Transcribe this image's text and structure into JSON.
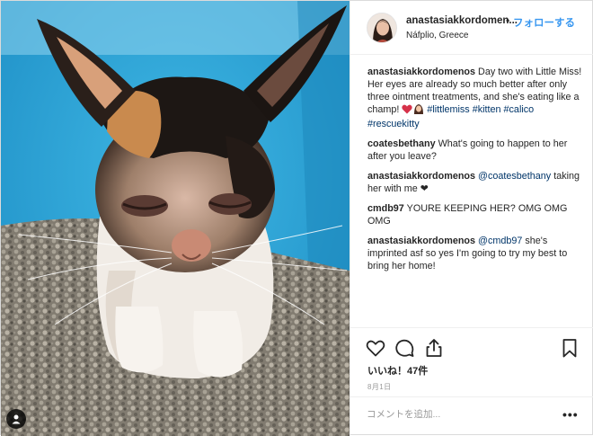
{
  "post": {
    "author": {
      "username": "anastasiakkordomen...",
      "location": "Náfplio, Greece",
      "follow_label": "フォローする",
      "separator": "•",
      "avatar_icon": "profile-avatar"
    },
    "photo": {
      "tag_icon": "person-tag-icon"
    },
    "caption": {
      "username": "anastasiakkordomenos",
      "text": " Day two with Little Miss! Her eyes are already so much better after only three ointment treatments, and she's eating like a champ! ",
      "hashtag_1": "#littlemiss",
      "hashtag_2": "#kitten",
      "hashtag_3": "#calico",
      "hashtag_4": "#rescuekitty"
    },
    "comments": [
      {
        "username": "coatesbethany",
        "text": " What's going to happen to her after you leave?"
      },
      {
        "username": "anastasiakkordomenos",
        "mention": "@coatesbethany",
        "text": " taking her with me ❤"
      },
      {
        "username": "cmdb97",
        "text": " YOURE KEEPING HER? OMG OMG OMG"
      },
      {
        "username": "anastasiakkordomenos",
        "mention": "@cmdb97",
        "text": " she's imprinted asf so yes I'm going to try my best to bring her home!"
      }
    ],
    "actions": {
      "like_icon": "heart-icon",
      "comment_icon": "comment-icon",
      "share_icon": "share-icon",
      "save_icon": "bookmark-icon"
    },
    "likes_text": "いいね！47件",
    "date_text": "8月1日",
    "add_comment": {
      "placeholder": "コメントを追加...",
      "more_label": "•••"
    },
    "colors": {
      "link": "#003569",
      "follow": "#3897f0",
      "border": "#efefef"
    }
  }
}
